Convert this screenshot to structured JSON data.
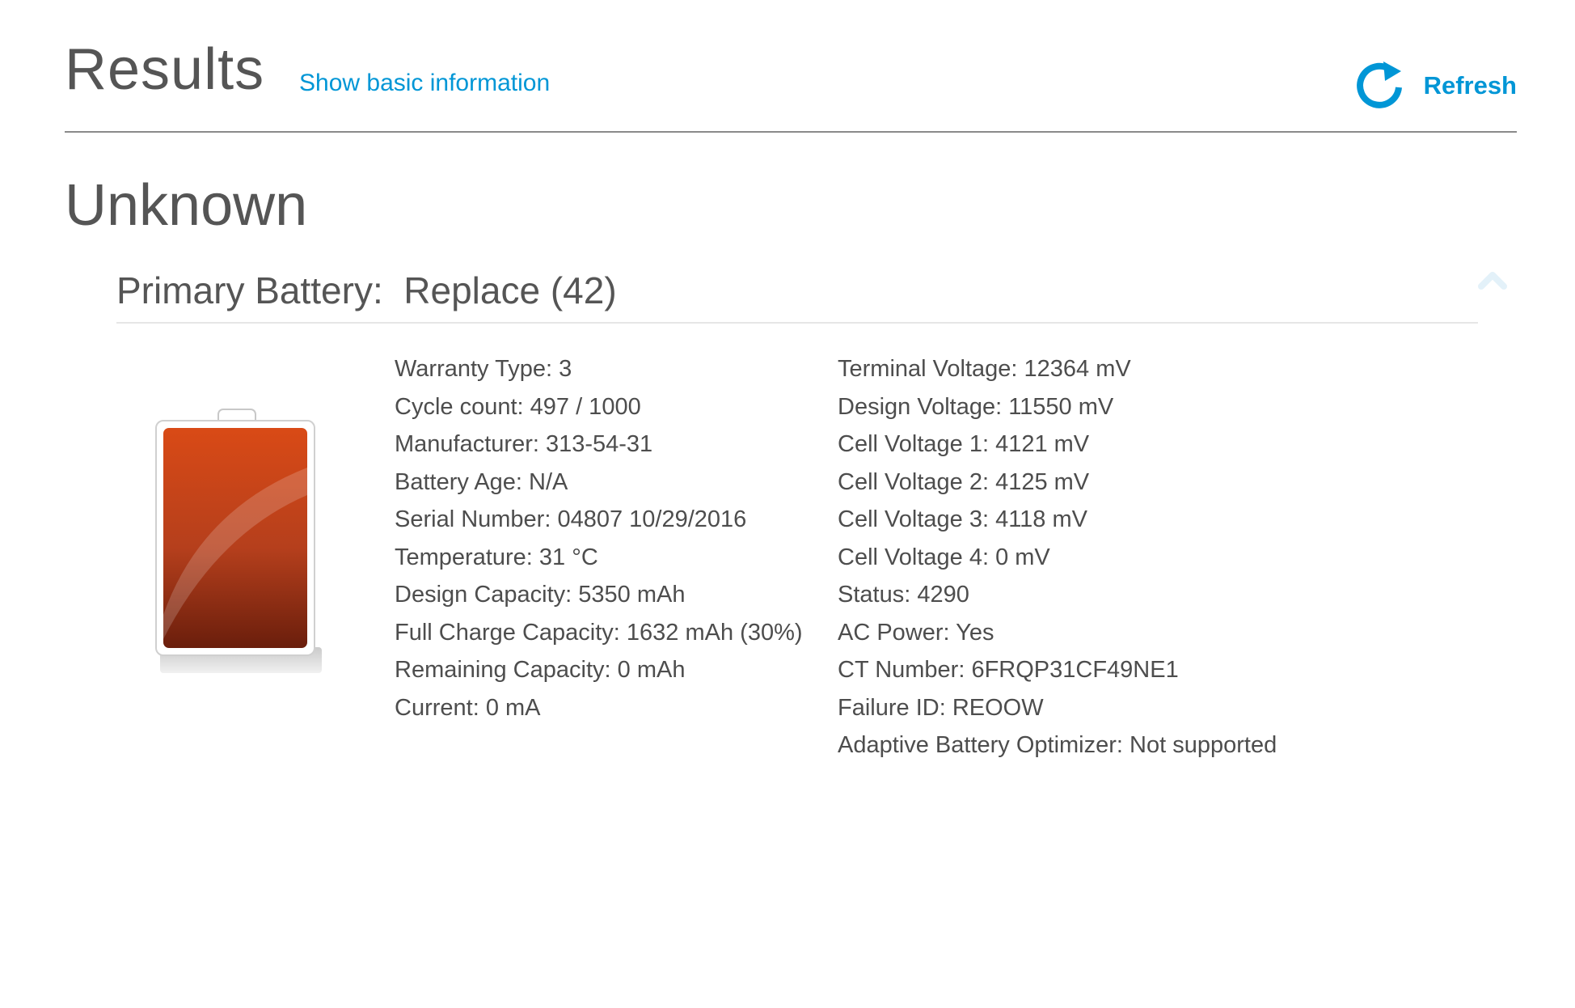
{
  "header": {
    "title": "Results",
    "basic_info_link": "Show basic information",
    "refresh_label": "Refresh",
    "refresh_icon": "refresh-icon"
  },
  "device": {
    "name": "Unknown"
  },
  "battery": {
    "section_title": "Primary Battery:  Replace (42)",
    "collapse_icon": "chevron-up-icon",
    "icon": "battery-icon",
    "colors": {
      "accent": "#0096d6",
      "battery_fill": "#c8421a"
    },
    "left_column": [
      "Warranty Type: 3",
      "Cycle count: 497 / 1000",
      "Manufacturer: 313-54-31",
      "Battery Age: N/A",
      "Serial Number: 04807 10/29/2016",
      "Temperature: 31 °C",
      "Design Capacity: 5350 mAh",
      "Full Charge Capacity: 1632 mAh (30%)",
      "Remaining Capacity: 0 mAh",
      "Current: 0 mA"
    ],
    "right_column": [
      "Terminal Voltage: 12364 mV",
      "Design Voltage: 11550 mV",
      "Cell Voltage 1: 4121 mV",
      "Cell Voltage 2: 4125 mV",
      "Cell Voltage 3: 4118 mV",
      "Cell Voltage 4: 0 mV",
      "Status: 4290",
      "AC Power: Yes",
      "CT Number: 6FRQP31CF49NE1",
      "Failure ID: REOOW",
      "Adaptive Battery Optimizer: Not supported"
    ]
  }
}
